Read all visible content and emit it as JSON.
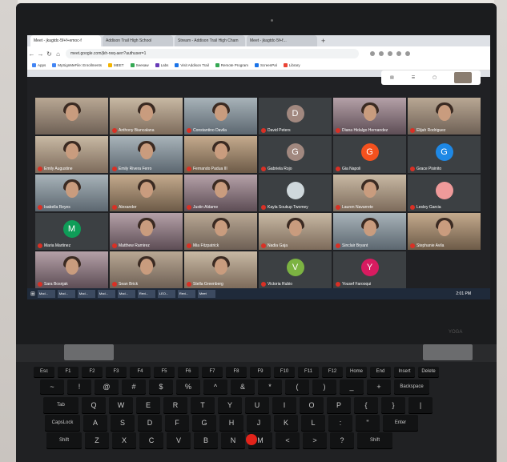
{
  "browser": {
    "tabs": [
      {
        "label": "Meet - jkagtdc-5f+f+emoc-f",
        "active": true
      },
      {
        "label": "Addison Trail High School",
        "active": false
      },
      {
        "label": "Stream - Addison Trail High Cham",
        "active": false
      },
      {
        "label": "Meet - jkagtdc-5f+f...",
        "active": false
      }
    ],
    "url": "meet.google.com/jkh-rwq-aerr?authuser=1",
    "bookmarks": [
      {
        "label": "Apps",
        "color": "#4285f4"
      },
      {
        "label": "MySignMeFile: Enrollments",
        "color": "#4285f4"
      },
      {
        "label": "MEET",
        "color": "#f4b400"
      },
      {
        "label": "Seesaw",
        "color": "#34a853"
      },
      {
        "label": "Labs",
        "color": "#673ab7"
      },
      {
        "label": "Visit Addison Trail",
        "color": "#1a73e8"
      },
      {
        "label": "Remote Program",
        "color": "#34a853"
      },
      {
        "label": "ScreenPal",
        "color": "#1a73e8"
      },
      {
        "label": "Library",
        "color": "#ea4335"
      }
    ]
  },
  "participants": [
    {
      "name": "",
      "type": "video"
    },
    {
      "name": "Anthony Biancalana",
      "type": "video"
    },
    {
      "name": "Constantino Davila",
      "type": "video"
    },
    {
      "name": "David Peters",
      "type": "avatar",
      "initial": "D",
      "color": "#a1887f"
    },
    {
      "name": "Diana Hidalgo Hernandez",
      "type": "video"
    },
    {
      "name": "Elijah Rodriguez",
      "type": "video"
    },
    {
      "name": "Emily Augustine",
      "type": "video"
    },
    {
      "name": "Emily Rivera Ferro",
      "type": "video"
    },
    {
      "name": "Fernando Padua III",
      "type": "video"
    },
    {
      "name": "Gabriela Rojo",
      "type": "avatar",
      "initial": "G",
      "color": "#a1887f"
    },
    {
      "name": "Gia Napoli",
      "type": "avatar",
      "initial": "G",
      "color": "#f4511e"
    },
    {
      "name": "Grace Pisinito",
      "type": "avatar",
      "initial": "G",
      "color": "#1e88e5"
    },
    {
      "name": "Isabella Reyes",
      "type": "video"
    },
    {
      "name": "Alexander",
      "type": "video"
    },
    {
      "name": "Justin Aldame",
      "type": "video"
    },
    {
      "name": "Kayla Soukup Twomey",
      "type": "avatar",
      "initial": "",
      "color": "#cfd8dc"
    },
    {
      "name": "Lauren Navarrete",
      "type": "video"
    },
    {
      "name": "Lesley Garcia",
      "type": "avatar",
      "initial": "",
      "color": "#ef9a9a"
    },
    {
      "name": "Maria Martinez",
      "type": "avatar",
      "initial": "M",
      "color": "#0f9d58"
    },
    {
      "name": "Matthew Ramirez",
      "type": "video"
    },
    {
      "name": "Mia Fitzpatrick",
      "type": "video"
    },
    {
      "name": "Nadia Gaja",
      "type": "video"
    },
    {
      "name": "Sinclair Bryant",
      "type": "video"
    },
    {
      "name": "Stephanie Avila",
      "type": "video"
    },
    {
      "name": "Sara Bosnjak",
      "type": "video"
    },
    {
      "name": "Sean Brick",
      "type": "video"
    },
    {
      "name": "Stella Greenberg",
      "type": "video"
    },
    {
      "name": "Victoria Rubio",
      "type": "avatar",
      "initial": "V",
      "color": "#7cb342"
    },
    {
      "name": "Yousef Farooqui",
      "type": "avatar",
      "initial": "Y",
      "color": "#d81b60"
    }
  ],
  "taskbar": {
    "apps": [
      "Mod...",
      "Mod...",
      "Mod...",
      "Mod...",
      "Mod...",
      "Revi...",
      "LEO...",
      "Revi...",
      "Meet"
    ],
    "time": "2:01 PM"
  },
  "keyboard": {
    "row_fn": [
      "Esc",
      "F1",
      "F2",
      "F3",
      "F4",
      "F5",
      "F6",
      "F7",
      "F8",
      "F9",
      "F10",
      "F11",
      "F12",
      "Home",
      "End",
      "Insert",
      "Delete"
    ],
    "row_num": [
      "~",
      "!",
      "@",
      "#",
      "$",
      "%",
      "^",
      "&",
      "*",
      "(",
      ")",
      "_",
      "+",
      "Backspace"
    ],
    "row_q": [
      "Tab",
      "Q",
      "W",
      "E",
      "R",
      "T",
      "Y",
      "U",
      "I",
      "O",
      "P",
      "{",
      "}",
      "|"
    ],
    "row_a": [
      "CapsLock",
      "A",
      "S",
      "D",
      "F",
      "G",
      "H",
      "J",
      "K",
      "L",
      ":",
      "\"",
      "Enter"
    ],
    "row_z": [
      "Shift",
      "Z",
      "X",
      "C",
      "V",
      "B",
      "N",
      "M",
      "<",
      ">",
      "?",
      "Shift"
    ]
  },
  "brand": "YOGA"
}
